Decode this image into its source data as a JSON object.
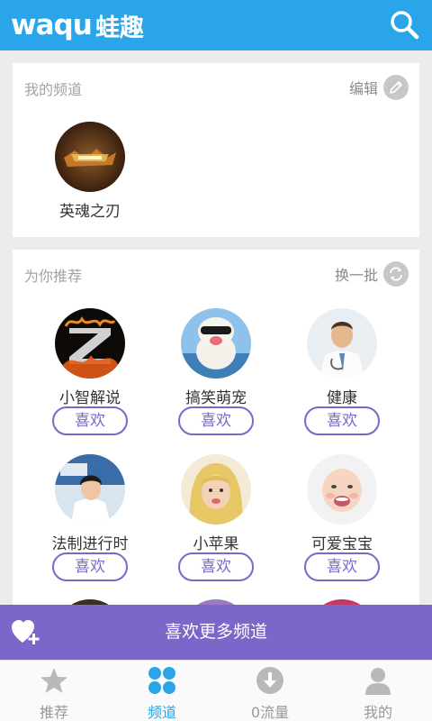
{
  "header": {
    "logo_latin": "waqu",
    "logo_cn": "蛙趣",
    "search_icon": "search-icon",
    "background_color": "#2ba5ea"
  },
  "my_channels": {
    "title": "我的频道",
    "action_label": "编辑",
    "action_icon": "pencil-icon",
    "items": [
      {
        "name": "英魂之刃"
      }
    ]
  },
  "recommended": {
    "title": "为你推荐",
    "action_label": "换一批",
    "action_icon": "refresh-icon",
    "like_label": "喜欢",
    "items": [
      {
        "name": "小智解说"
      },
      {
        "name": "搞笑萌宠"
      },
      {
        "name": "健康"
      },
      {
        "name": "法制进行时"
      },
      {
        "name": "小苹果"
      },
      {
        "name": "可爱宝宝"
      }
    ]
  },
  "more_bar": {
    "label": "喜欢更多频道",
    "icon": "heart-plus-icon",
    "background_color": "#7c66c9"
  },
  "tabs": [
    {
      "label": "推荐",
      "icon": "star-icon",
      "active": false
    },
    {
      "label": "频道",
      "icon": "grid-dots-icon",
      "active": true
    },
    {
      "label": "0流量",
      "icon": "download-icon",
      "active": false
    },
    {
      "label": "我的",
      "icon": "user-icon",
      "active": false
    }
  ],
  "colors": {
    "accent_blue": "#2ba5ea",
    "accent_purple": "#7b67c9",
    "page_background": "#ececec"
  }
}
